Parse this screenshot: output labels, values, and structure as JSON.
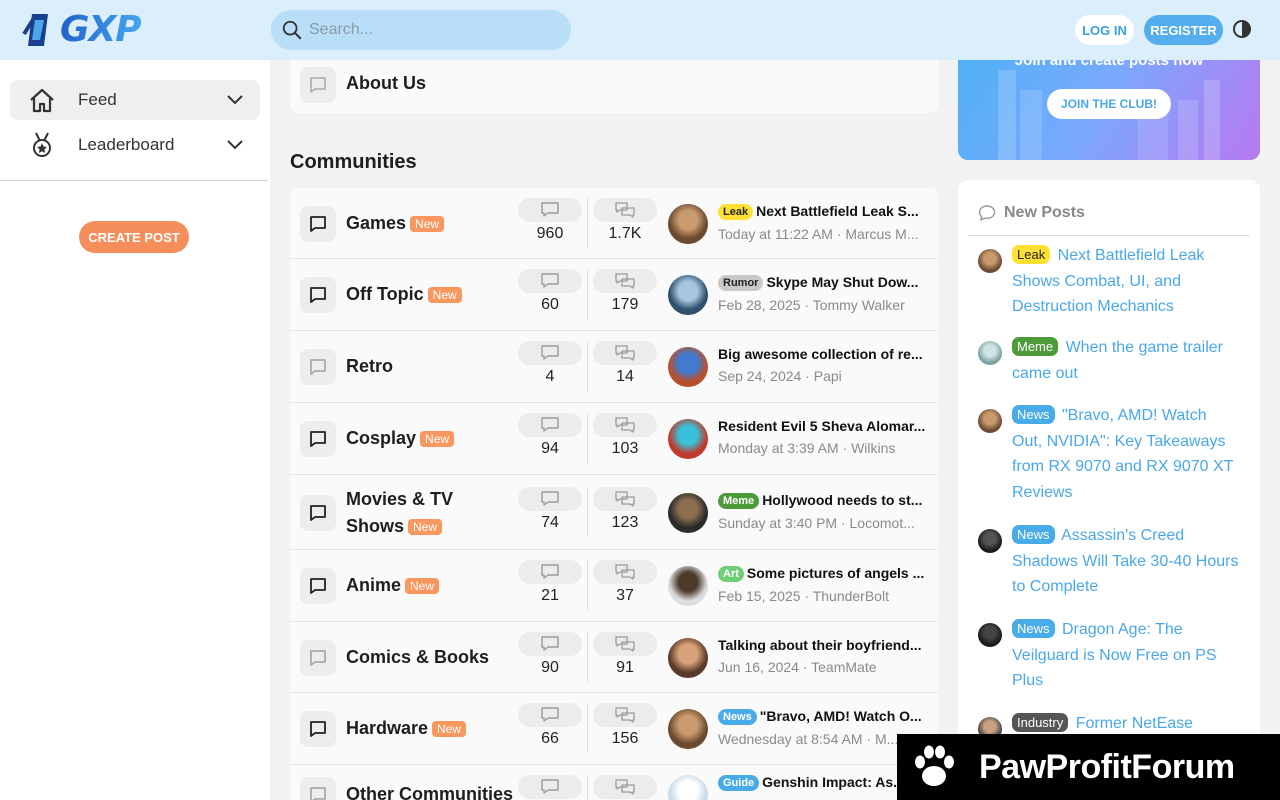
{
  "header": {
    "logo_text": "GXP",
    "search_placeholder": "Search...",
    "login_label": "LOG IN",
    "register_label": "REGISTER"
  },
  "sidebar": {
    "items": [
      {
        "label": "Feed",
        "icon": "home-icon"
      },
      {
        "label": "Leaderboard",
        "icon": "medal-icon"
      }
    ],
    "create_post_label": "CREATE POST"
  },
  "main": {
    "about_title": "About Us",
    "section_title": "Communities",
    "new_tag": "New",
    "communities": [
      {
        "name": "Games",
        "is_new": true,
        "messages": "960",
        "threads": "1.7K",
        "latest_tag": "Leak",
        "latest_title": "Next Battlefield Leak S...",
        "latest_meta": "Today at 11:22 AM · Marcus M..."
      },
      {
        "name": "Off Topic",
        "is_new": true,
        "messages": "60",
        "threads": "179",
        "latest_tag": "Rumor",
        "latest_title": "Skype May Shut Dow...",
        "latest_meta": "Feb 28, 2025 · Tommy Walker"
      },
      {
        "name": "Retro",
        "is_new": false,
        "messages": "4",
        "threads": "14",
        "latest_tag": "",
        "latest_title": "Big awesome collection of re...",
        "latest_meta": "Sep 24, 2024 · Papi"
      },
      {
        "name": "Cosplay",
        "is_new": true,
        "messages": "94",
        "threads": "103",
        "latest_tag": "",
        "latest_title": "Resident Evil 5 Sheva Alomar...",
        "latest_meta": "Monday at 3:39 AM · Wilkins"
      },
      {
        "name": "Movies & TV Shows",
        "is_new": true,
        "messages": "74",
        "threads": "123",
        "latest_tag": "Meme",
        "latest_title": "Hollywood needs to st...",
        "latest_meta": "Sunday at 3:40 PM · Locomot..."
      },
      {
        "name": "Anime",
        "is_new": true,
        "messages": "21",
        "threads": "37",
        "latest_tag": "Art",
        "latest_title": "Some pictures of angels ...",
        "latest_meta": "Feb 15, 2025 · ThunderBolt"
      },
      {
        "name": "Comics & Books",
        "is_new": false,
        "messages": "90",
        "threads": "91",
        "latest_tag": "",
        "latest_title": "Talking about their boyfriend...",
        "latest_meta": "Jun 16, 2024 · TeamMate"
      },
      {
        "name": "Hardware",
        "is_new": true,
        "messages": "66",
        "threads": "156",
        "latest_tag": "News",
        "latest_title": "\"Bravo, AMD! Watch O...",
        "latest_meta": "Wednesday at 8:54 AM · M..."
      },
      {
        "name": "Other Communities",
        "is_new": false,
        "messages": "",
        "threads": "",
        "latest_tag": "Guide",
        "latest_title": "Genshin Impact: As...",
        "latest_meta": ""
      }
    ]
  },
  "right": {
    "banner_text": "Join and create posts now",
    "join_label": "JOIN THE CLUB!",
    "new_posts_title": "New Posts",
    "new_posts": [
      {
        "tag": "Leak",
        "title": "Next Battlefield Leak Shows Combat, UI, and Destruction Mechanics"
      },
      {
        "tag": "Meme",
        "title": "When the game trailer came out"
      },
      {
        "tag": "News",
        "title": "\"Bravo, AMD! Watch Out, NVIDIA\": Key Takeaways from RX 9070 and RX 9070 XT Reviews"
      },
      {
        "tag": "News",
        "title": "Assassin's Creed Shadows Will Take 30-40 Hours to Complete"
      },
      {
        "tag": "News",
        "title": "Dragon Age: The Veilguard is Now Free on PS Plus"
      },
      {
        "tag": "Industry",
        "title": "Former NetEase"
      }
    ]
  },
  "watermark": {
    "text": "PawProfitForum"
  },
  "colors": {
    "accent": "#54aeee",
    "orange": "#f68e5b",
    "header_bg": "#daeefb"
  }
}
